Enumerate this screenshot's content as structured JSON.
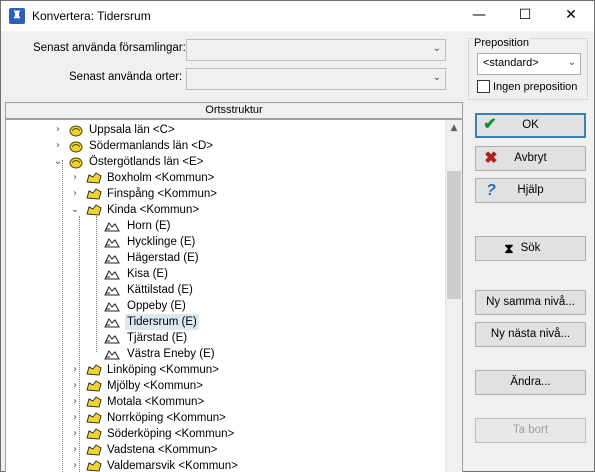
{
  "window": {
    "title": "Konvertera: Tidersrum"
  },
  "fields": {
    "parish_label": "Senast använda församlingar:",
    "places_label": "Senast använda orter:",
    "parish_value": "",
    "places_value": ""
  },
  "preposition": {
    "group_title": "Preposition",
    "selected": "<standard>",
    "no_prep_label": "Ingen preposition"
  },
  "tree": {
    "header": "Ortsstruktur",
    "rows": [
      {
        "label": "Uppsala län <C>",
        "level": 0,
        "icon": "county",
        "expander": "collapsed"
      },
      {
        "label": "Södermanlands län <D>",
        "level": 0,
        "icon": "county",
        "expander": "collapsed"
      },
      {
        "label": "Östergötlands län <E>",
        "level": 0,
        "icon": "county",
        "expander": "expanded"
      },
      {
        "label": "Boxholm <Kommun>",
        "level": 1,
        "icon": "municipality",
        "expander": "collapsed"
      },
      {
        "label": "Finspång <Kommun>",
        "level": 1,
        "icon": "municipality",
        "expander": "collapsed"
      },
      {
        "label": "Kinda <Kommun>",
        "level": 1,
        "icon": "municipality",
        "expander": "expanded"
      },
      {
        "label": "Horn (E)",
        "level": 2,
        "icon": "parish",
        "expander": "none"
      },
      {
        "label": "Hycklinge (E)",
        "level": 2,
        "icon": "parish",
        "expander": "none"
      },
      {
        "label": "Hägerstad (E)",
        "level": 2,
        "icon": "parish",
        "expander": "none"
      },
      {
        "label": "Kisa (E)",
        "level": 2,
        "icon": "parish",
        "expander": "none"
      },
      {
        "label": "Kättilstad (E)",
        "level": 2,
        "icon": "parish",
        "expander": "none"
      },
      {
        "label": "Oppeby (E)",
        "level": 2,
        "icon": "parish",
        "expander": "none"
      },
      {
        "label": "Tidersrum (E)",
        "level": 2,
        "icon": "parish",
        "expander": "none",
        "selected": true
      },
      {
        "label": "Tjärstad (E)",
        "level": 2,
        "icon": "parish",
        "expander": "none"
      },
      {
        "label": "Västra Eneby (E)",
        "level": 2,
        "icon": "parish",
        "expander": "none"
      },
      {
        "label": "Linköping <Kommun>",
        "level": 1,
        "icon": "municipality",
        "expander": "collapsed"
      },
      {
        "label": "Mjölby <Kommun>",
        "level": 1,
        "icon": "municipality",
        "expander": "collapsed"
      },
      {
        "label": "Motala <Kommun>",
        "level": 1,
        "icon": "municipality",
        "expander": "collapsed"
      },
      {
        "label": "Norrköping <Kommun>",
        "level": 1,
        "icon": "municipality",
        "expander": "collapsed"
      },
      {
        "label": "Söderköping <Kommun>",
        "level": 1,
        "icon": "municipality",
        "expander": "collapsed"
      },
      {
        "label": "Vadstena <Kommun>",
        "level": 1,
        "icon": "municipality",
        "expander": "collapsed"
      },
      {
        "label": "Valdemarsvik <Kommun>",
        "level": 1,
        "icon": "municipality",
        "expander": "collapsed"
      }
    ]
  },
  "buttons": {
    "ok": "OK",
    "cancel": "Avbryt",
    "help": "Hjälp",
    "search": "Sök",
    "new_same_level": "Ny samma nivå...",
    "new_next_level": "Ny nästa nivå...",
    "edit": "Ändra...",
    "remove": "Ta bort"
  },
  "colors": {
    "accent": "#3c7fb1",
    "selection": "#dde8f3",
    "county_icon": "#f2d22f",
    "ok_check": "#1a8a2a",
    "cancel_x": "#b01e1e",
    "help_q": "#2c6fb7"
  },
  "icons": {
    "app": "app-icon",
    "county": "county-icon",
    "municipality": "municipality-icon",
    "parish": "parish-icon"
  }
}
